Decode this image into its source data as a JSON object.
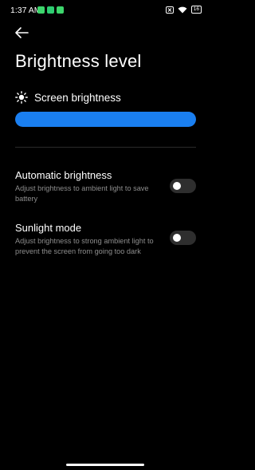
{
  "status_bar": {
    "time": "1:37 AM",
    "battery": "16"
  },
  "header": {
    "title": "Brightness level"
  },
  "screen_brightness": {
    "label": "Screen brightness",
    "level": 1.0
  },
  "settings": [
    {
      "title": "Automatic brightness",
      "description": "Adjust brightness to ambient light to save battery",
      "enabled": false
    },
    {
      "title": "Sunlight mode",
      "description": "Adjust brightness to strong ambient light to prevent the screen from going too dark",
      "enabled": false
    }
  ],
  "colors": {
    "accent": "#1a7ff0",
    "background": "#000000",
    "toggle_off": "#2e2e2e"
  }
}
